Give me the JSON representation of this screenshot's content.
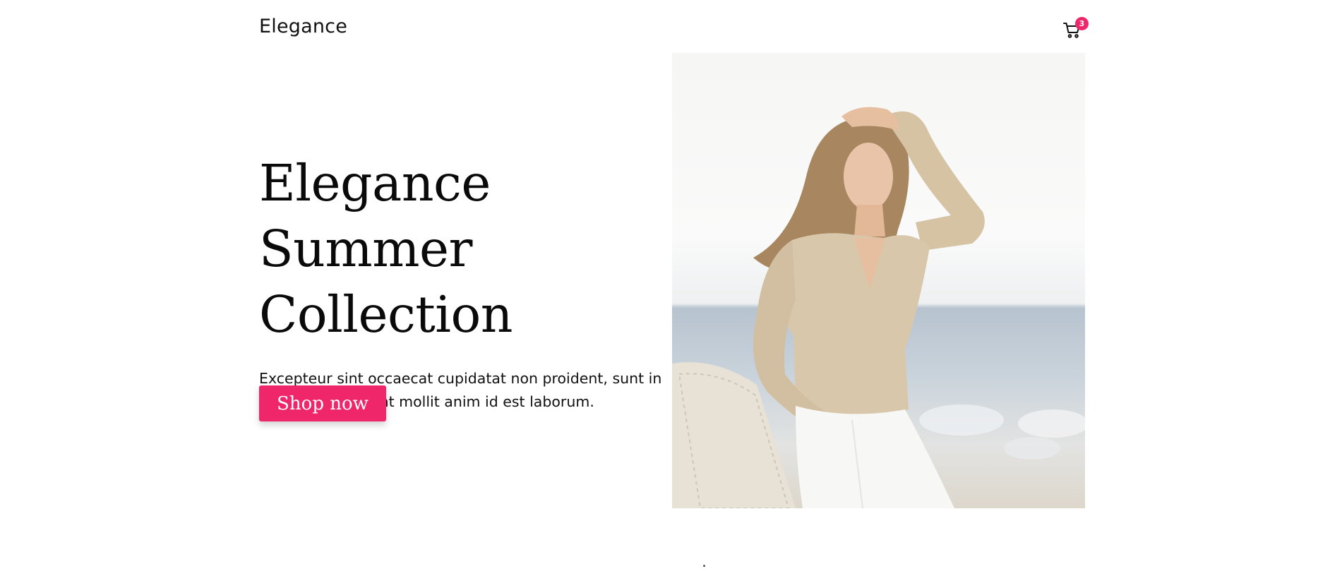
{
  "header": {
    "logo": "Elegance",
    "cart_count": "3"
  },
  "hero": {
    "title_line1": "Elegance Summer",
    "title_line2": "Collection",
    "description": "Excepteur sint occaecat cupidatat non proident, sunt in culpa qui deserunt mollit anim id est laborum.",
    "cta_label": "Shop now"
  },
  "colors": {
    "accent": "#f0266b",
    "text": "#111111",
    "background": "#ffffff"
  },
  "icons": {
    "cart": "shopping-cart-icon"
  }
}
